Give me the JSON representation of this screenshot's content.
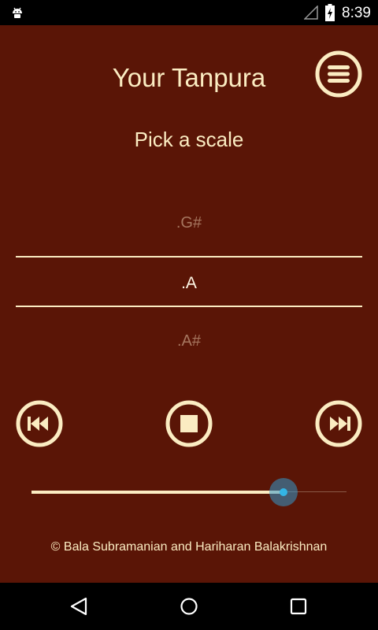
{
  "status_bar": {
    "time": "8:39"
  },
  "app": {
    "title": "Your Tanpura",
    "subtitle": "Pick a scale"
  },
  "scale_picker": {
    "previous": ".G#",
    "selected": ".A",
    "next": ".A#"
  },
  "volume_slider": {
    "value_fraction": 0.8
  },
  "footer": {
    "copyright": "© Bala Subramanian and Hariharan Balakrishnan"
  },
  "colors": {
    "background": "#5a1506",
    "cream": "#fbecc2",
    "accent_blue": "#33b5e5"
  },
  "icons": {
    "menu": "hamburger-menu-icon",
    "previous": "skip-previous-icon",
    "stop": "stop-icon",
    "next": "skip-next-icon"
  }
}
